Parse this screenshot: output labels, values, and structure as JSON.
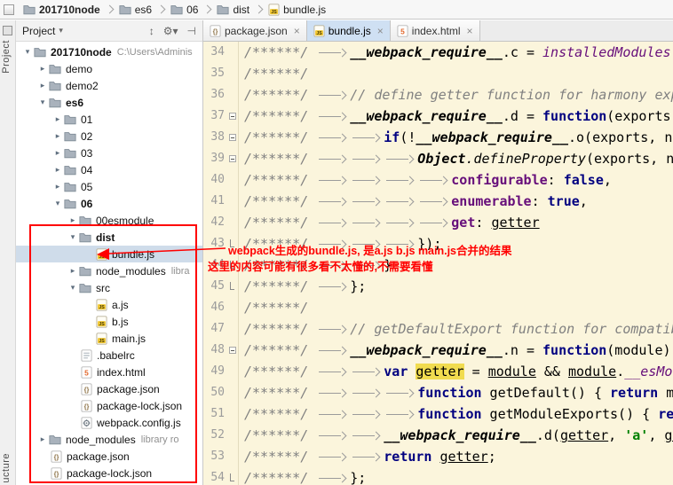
{
  "navbar": {
    "crumbs": [
      {
        "label": "201710node",
        "icon": "folder",
        "bold": true
      },
      {
        "label": "es6",
        "icon": "folder"
      },
      {
        "label": "06",
        "icon": "folder"
      },
      {
        "label": "dist",
        "icon": "folder"
      },
      {
        "label": "bundle.js",
        "icon": "js"
      }
    ]
  },
  "tool_stripe": {
    "top_label": "Project",
    "bottom_label": "ucture"
  },
  "project_panel": {
    "title": "Project",
    "title_chevron": "▾",
    "header_icons": [
      {
        "name": "collapse-all",
        "glyph": "↕"
      },
      {
        "name": "settings-gear",
        "glyph": "⚙▾"
      },
      {
        "name": "hide-panel",
        "glyph": "⊣"
      }
    ],
    "tree": [
      {
        "label": "201710node",
        "suffix": "C:\\Users\\Adminis",
        "icon": "folder",
        "depth": 0,
        "chevron": "expanded",
        "bold": true
      },
      {
        "label": "demo",
        "icon": "folder",
        "depth": 1,
        "chevron": "collapsed"
      },
      {
        "label": "demo2",
        "icon": "folder",
        "depth": 1,
        "chevron": "collapsed"
      },
      {
        "label": "es6",
        "icon": "folder",
        "depth": 1,
        "chevron": "expanded",
        "bold": true
      },
      {
        "label": "01",
        "icon": "folder",
        "depth": 2,
        "chevron": "collapsed"
      },
      {
        "label": "02",
        "icon": "folder",
        "depth": 2,
        "chevron": "collapsed"
      },
      {
        "label": "03",
        "icon": "folder",
        "depth": 2,
        "chevron": "collapsed"
      },
      {
        "label": "04",
        "icon": "folder",
        "depth": 2,
        "chevron": "collapsed"
      },
      {
        "label": "05",
        "icon": "folder",
        "depth": 2,
        "chevron": "collapsed"
      },
      {
        "label": "06",
        "icon": "folder",
        "depth": 2,
        "chevron": "expanded",
        "bold": true
      },
      {
        "label": "00esmodule",
        "icon": "folder",
        "depth": 3,
        "chevron": "collapsed"
      },
      {
        "label": "dist",
        "icon": "folder",
        "depth": 3,
        "chevron": "expanded",
        "bold": true
      },
      {
        "label": "bundle.js",
        "icon": "js",
        "depth": 4,
        "selected": true
      },
      {
        "label": "node_modules",
        "suffix": "libra",
        "icon": "folder",
        "depth": 3,
        "chevron": "collapsed"
      },
      {
        "label": "src",
        "icon": "folder",
        "depth": 3,
        "chevron": "expanded"
      },
      {
        "label": "a.js",
        "icon": "js",
        "depth": 4
      },
      {
        "label": "b.js",
        "icon": "js",
        "depth": 4
      },
      {
        "label": "main.js",
        "icon": "js",
        "depth": 4
      },
      {
        "label": ".babelrc",
        "icon": "file",
        "depth": 3
      },
      {
        "label": "index.html",
        "icon": "html",
        "depth": 3
      },
      {
        "label": "package.json",
        "icon": "json",
        "depth": 3
      },
      {
        "label": "package-lock.json",
        "icon": "json",
        "depth": 3
      },
      {
        "label": "webpack.config.js",
        "icon": "config",
        "depth": 3
      },
      {
        "label": "node_modules",
        "suffix": "library ro",
        "icon": "folder",
        "depth": 1,
        "chevron": "collapsed"
      },
      {
        "label": "package.json",
        "icon": "json",
        "depth": 1
      },
      {
        "label": "package-lock.json",
        "icon": "json",
        "depth": 1
      }
    ]
  },
  "editor": {
    "tabs": [
      {
        "label": "package.json",
        "icon": "json",
        "active": false
      },
      {
        "label": "bundle.js",
        "icon": "js",
        "active": true
      },
      {
        "label": "index.html",
        "icon": "html",
        "active": false
      }
    ],
    "close_glyph": "×",
    "lines": [
      {
        "n": 34,
        "toks": [
          [
            "cm",
            "/******/ "
          ],
          [
            "tab"
          ],
          [
            "wr",
            "__webpack_require__"
          ],
          [
            "tx",
            ".c = "
          ],
          [
            "fld",
            "installedModules"
          ],
          [
            "tx",
            ";"
          ]
        ]
      },
      {
        "n": 35,
        "toks": [
          [
            "cm",
            "/******/"
          ]
        ]
      },
      {
        "n": 36,
        "toks": [
          [
            "cm",
            "/******/ "
          ],
          [
            "tab"
          ],
          [
            "cm",
            "// define getter function for harmony exports"
          ]
        ]
      },
      {
        "n": 37,
        "fold": "start",
        "toks": [
          [
            "cm",
            "/******/ "
          ],
          [
            "tab"
          ],
          [
            "wr",
            "__webpack_require__"
          ],
          [
            "tx",
            ".d = "
          ],
          [
            "kw",
            "function"
          ],
          [
            "tx",
            "(exports, name, getter) {"
          ]
        ]
      },
      {
        "n": 38,
        "fold": "start",
        "toks": [
          [
            "cm",
            "/******/ "
          ],
          [
            "tab"
          ],
          [
            "tab"
          ],
          [
            "kw",
            "if"
          ],
          [
            "tx",
            "(!"
          ],
          [
            "wr",
            "__webpack_require__"
          ],
          [
            "tx",
            ".o(exports, name)) {"
          ]
        ]
      },
      {
        "n": 39,
        "fold": "start",
        "toks": [
          [
            "cm",
            "/******/ "
          ],
          [
            "tab"
          ],
          [
            "tab"
          ],
          [
            "tab"
          ],
          [
            "cls",
            "Object"
          ],
          [
            "mth",
            ".defineProperty"
          ],
          [
            "tx",
            "(exports, name, {"
          ]
        ]
      },
      {
        "n": 40,
        "toks": [
          [
            "cm",
            "/******/ "
          ],
          [
            "tab"
          ],
          [
            "tab"
          ],
          [
            "tab"
          ],
          [
            "tab"
          ],
          [
            "prop",
            "configurable"
          ],
          [
            "tx",
            ": "
          ],
          [
            "kw",
            "false"
          ],
          [
            "tx",
            ","
          ]
        ]
      },
      {
        "n": 41,
        "toks": [
          [
            "cm",
            "/******/ "
          ],
          [
            "tab"
          ],
          [
            "tab"
          ],
          [
            "tab"
          ],
          [
            "tab"
          ],
          [
            "prop",
            "enumerable"
          ],
          [
            "tx",
            ": "
          ],
          [
            "kw",
            "true"
          ],
          [
            "tx",
            ","
          ]
        ]
      },
      {
        "n": 42,
        "toks": [
          [
            "cm",
            "/******/ "
          ],
          [
            "tab"
          ],
          [
            "tab"
          ],
          [
            "tab"
          ],
          [
            "tab"
          ],
          [
            "prop",
            "get"
          ],
          [
            "tx",
            ": "
          ],
          [
            "idu",
            "getter"
          ]
        ]
      },
      {
        "n": 43,
        "fold": "end",
        "toks": [
          [
            "cm",
            "/******/ "
          ],
          [
            "tab"
          ],
          [
            "tab"
          ],
          [
            "tab"
          ],
          [
            "tx",
            "});"
          ]
        ]
      },
      {
        "n": 44,
        "fold": "end",
        "toks": [
          [
            "cm",
            "/******/ "
          ],
          [
            "tab"
          ],
          [
            "tab"
          ],
          [
            "tx",
            "}"
          ]
        ]
      },
      {
        "n": 45,
        "fold": "end",
        "toks": [
          [
            "cm",
            "/******/ "
          ],
          [
            "tab"
          ],
          [
            "tx",
            "};"
          ]
        ]
      },
      {
        "n": 46,
        "toks": [
          [
            "cm",
            "/******/"
          ]
        ]
      },
      {
        "n": 47,
        "toks": [
          [
            "cm",
            "/******/ "
          ],
          [
            "tab"
          ],
          [
            "cm",
            "// getDefaultExport function for compatibility with non-harmony modules"
          ]
        ]
      },
      {
        "n": 48,
        "fold": "start",
        "toks": [
          [
            "cm",
            "/******/ "
          ],
          [
            "tab"
          ],
          [
            "wr",
            "__webpack_require__"
          ],
          [
            "tx",
            ".n = "
          ],
          [
            "kw",
            "function"
          ],
          [
            "tx",
            "(module) {"
          ]
        ]
      },
      {
        "n": 49,
        "toks": [
          [
            "cm",
            "/******/ "
          ],
          [
            "tab"
          ],
          [
            "tab"
          ],
          [
            "kw",
            "var "
          ],
          [
            "hl",
            "getter"
          ],
          [
            "tx",
            " = "
          ],
          [
            "idu",
            "module"
          ],
          [
            "tx",
            " && "
          ],
          [
            "idu",
            "module"
          ],
          [
            "tx",
            "."
          ],
          [
            "fld",
            "__esModule"
          ],
          [
            "tx",
            " ?"
          ]
        ]
      },
      {
        "n": 50,
        "toks": [
          [
            "cm",
            "/******/ "
          ],
          [
            "tab"
          ],
          [
            "tab"
          ],
          [
            "tab"
          ],
          [
            "kw",
            "function"
          ],
          [
            "tx",
            " getDefault() { "
          ],
          [
            "kw",
            "return"
          ],
          [
            "tx",
            " module['default']; } :"
          ]
        ]
      },
      {
        "n": 51,
        "toks": [
          [
            "cm",
            "/******/ "
          ],
          [
            "tab"
          ],
          [
            "tab"
          ],
          [
            "tab"
          ],
          [
            "kw",
            "function"
          ],
          [
            "tx",
            " getModuleExports() { "
          ],
          [
            "kw",
            "return"
          ],
          [
            "tx",
            " module; };"
          ]
        ]
      },
      {
        "n": 52,
        "toks": [
          [
            "cm",
            "/******/ "
          ],
          [
            "tab"
          ],
          [
            "tab"
          ],
          [
            "wr",
            "__webpack_require__"
          ],
          [
            "tx",
            ".d("
          ],
          [
            "idu",
            "getter"
          ],
          [
            "tx",
            ", "
          ],
          [
            "str",
            "'a'"
          ],
          [
            "tx",
            ", "
          ],
          [
            "idu",
            "getter"
          ],
          [
            "tx",
            ");"
          ]
        ]
      },
      {
        "n": 53,
        "toks": [
          [
            "cm",
            "/******/ "
          ],
          [
            "tab"
          ],
          [
            "tab"
          ],
          [
            "kw",
            "return "
          ],
          [
            "idu",
            "getter"
          ],
          [
            "tx",
            ";"
          ]
        ]
      },
      {
        "n": 54,
        "fold": "end",
        "toks": [
          [
            "cm",
            "/******/ "
          ],
          [
            "tab"
          ],
          [
            "tx",
            "};"
          ]
        ]
      }
    ]
  },
  "annotation": {
    "line1": "webpack生成的bundle.js, 是a.js b.js main.js合并的结果",
    "line2": "这里的内容可能有很多看不太懂的,不需要看懂"
  },
  "colors": {
    "annotation_red": "#ff0000",
    "editor_bg": "#fbf5dc",
    "keyword": "#000080",
    "comment": "#808080",
    "string": "#008000",
    "property": "#660e7a",
    "selection_bg": "#cfdcea",
    "active_tab_bg": "#cfe0f3"
  }
}
